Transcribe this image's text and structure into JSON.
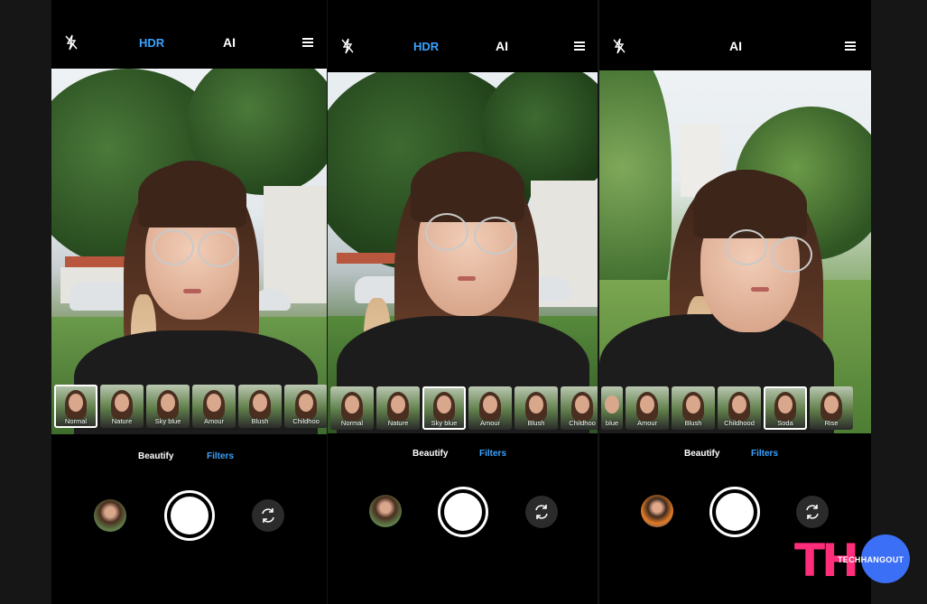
{
  "panels": [
    {
      "top": {
        "hdr": "HDR",
        "ai": "AI"
      },
      "filters": [
        {
          "label": "Normal",
          "selected": true
        },
        {
          "label": "Nature",
          "selected": false
        },
        {
          "label": "Sky blue",
          "selected": false
        },
        {
          "label": "Amour",
          "selected": false
        },
        {
          "label": "Blush",
          "selected": false
        },
        {
          "label": "Childhoo",
          "selected": false
        }
      ],
      "modes": {
        "beautify": "Beautify",
        "filters": "Filters"
      }
    },
    {
      "top": {
        "hdr": "HDR",
        "ai": "AI"
      },
      "filters": [
        {
          "label": "Normal",
          "selected": false
        },
        {
          "label": "Nature",
          "selected": false
        },
        {
          "label": "Sky blue",
          "selected": true
        },
        {
          "label": "Amour",
          "selected": false
        },
        {
          "label": "Blush",
          "selected": false
        },
        {
          "label": "Childhoo",
          "selected": false
        }
      ],
      "modes": {
        "beautify": "Beautify",
        "filters": "Filters"
      }
    },
    {
      "top": {
        "ai": "AI"
      },
      "filters": [
        {
          "label": "blue",
          "selected": false
        },
        {
          "label": "Amour",
          "selected": false
        },
        {
          "label": "Blush",
          "selected": false
        },
        {
          "label": "Childhood",
          "selected": false
        },
        {
          "label": "Soda",
          "selected": true
        },
        {
          "label": "Rise",
          "selected": false
        }
      ],
      "modes": {
        "beautify": "Beautify",
        "filters": "Filters"
      }
    }
  ],
  "watermark": {
    "initials": "TH",
    "name": "TECHHANGOUT"
  },
  "colors": {
    "accent": "#3aa3ff",
    "brand_pink": "#ff2d7a",
    "brand_blue": "#3b6ff5"
  },
  "icons": {
    "flash": "flash-off-icon",
    "menu": "menu-icon",
    "flip": "switch-camera-icon"
  }
}
